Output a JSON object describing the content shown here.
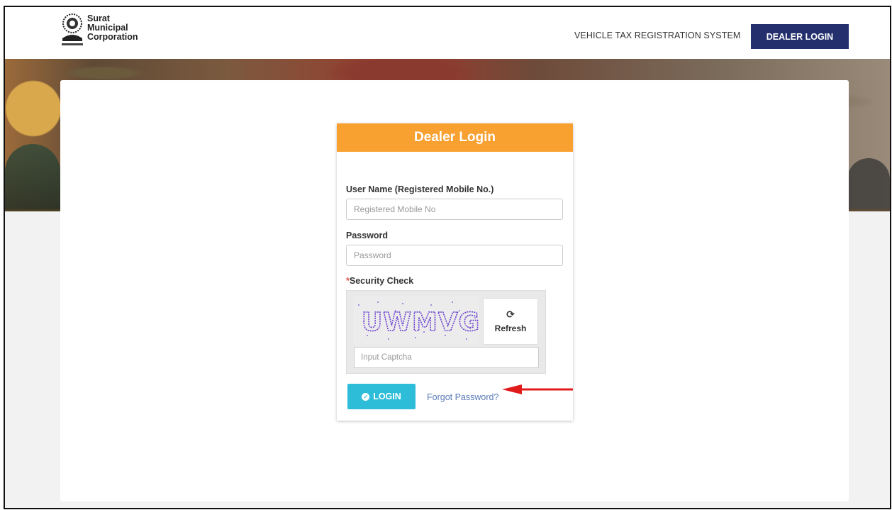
{
  "header": {
    "logo_lines": [
      "Surat",
      "Municipal",
      "Corporation"
    ],
    "system_title": "VEHICLE TAX REGISTRATION SYSTEM",
    "dealer_login_button": "DEALER LOGIN"
  },
  "login_form": {
    "title": "Dealer Login",
    "username_label": "User Name (Registered Mobile No.)",
    "username_placeholder": "Registered Mobile No",
    "password_label": "Password",
    "password_placeholder": "Password",
    "security_required_mark": "*",
    "security_label": "Security Check",
    "captcha_text": "UWMVG",
    "refresh_label": "Refresh",
    "captcha_placeholder": "Input Captcha",
    "login_button": "LOGIN",
    "forgot_password_link": "Forgot Password?"
  },
  "colors": {
    "header_button": "#24306d",
    "card_header": "#f8a030",
    "login_button": "#2ebdd8",
    "link": "#5a7bb8",
    "banner_border": "#f5921e",
    "annotation_arrow": "#e01b1b"
  },
  "icons": {
    "logo": "municipal-emblem-icon",
    "refresh": "refresh-icon",
    "login": "check-circle-icon",
    "annotation": "red-arrow-icon"
  }
}
